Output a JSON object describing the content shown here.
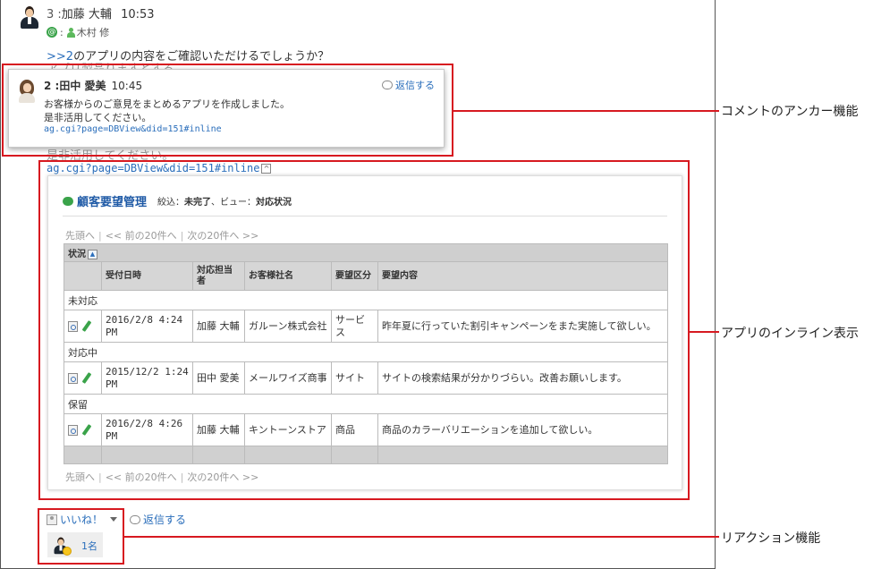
{
  "comment": {
    "number": "3 :",
    "author": "加藤 大輔",
    "time": "10:53",
    "mention_sep": ":",
    "mention_user": "木村 修",
    "anchor_ref": ">>2",
    "text": "のアプリの内容をご確認いただけるでしょうか？",
    "ghost_text_1": "アプリ製品りますとする",
    "ghost_text_2": "是非活用してください。",
    "inline_link": "ag.cgi?page=DBView&did=151#inline",
    "collapse_icon": "^"
  },
  "popup": {
    "number": "2 :",
    "author": "田中 愛美",
    "time": "10:45",
    "reply_label": "返信する",
    "text_line1": "お客様からのご意見をまとめるアプリを作成しました。",
    "text_line2": "是非活用してください。",
    "link": "ag.cgi?page=DBView&did=151#inline"
  },
  "app": {
    "name": "顧客要望管理",
    "filter_label": "絞込：",
    "filter_value": "未完了",
    "view_label": "、ビュー：",
    "view_value": "対応状況",
    "pager": {
      "first": "先頭へ",
      "prev": "<< 前の20件へ",
      "next": "次の20件へ >>"
    },
    "group_header": "状況",
    "sort_icon": "▲",
    "columns": [
      "受付日時",
      "対応担当者",
      "お客様社名",
      "要望区分",
      "要望内容"
    ],
    "groups": [
      {
        "label": "未対応",
        "rows": [
          {
            "date": "2016/2/8 4:24 PM",
            "assignee": "加藤 大輔",
            "company": "ガルーン株式会社",
            "category": "サービス",
            "content": "昨年夏に行っていた割引キャンペーンをまた実施して欲しい。"
          }
        ]
      },
      {
        "label": "対応中",
        "rows": [
          {
            "date": "2015/12/2 1:24 PM",
            "assignee": "田中 愛美",
            "company": "メールワイズ商事",
            "category": "サイト",
            "content": "サイトの検索結果が分かりづらい。改善お願いします。"
          }
        ]
      },
      {
        "label": "保留",
        "rows": [
          {
            "date": "2016/2/8 4:26 PM",
            "assignee": "加藤 大輔",
            "company": "キントーンストア",
            "category": "商品",
            "content": "商品のカラーバリエーションを追加して欲しい。"
          }
        ]
      }
    ]
  },
  "reactions": {
    "like_label": "いいね！",
    "reply_label": "返信する",
    "count": "1名"
  },
  "annotations": {
    "anchor": "コメントのアンカー機能",
    "inline": "アプリのインライン表示",
    "reaction": "リアクション機能"
  },
  "colors": {
    "annotation": "#d71920",
    "link": "#2a6ebb",
    "app_title": "#1f5aa6",
    "accent_green": "#3aa34a"
  }
}
